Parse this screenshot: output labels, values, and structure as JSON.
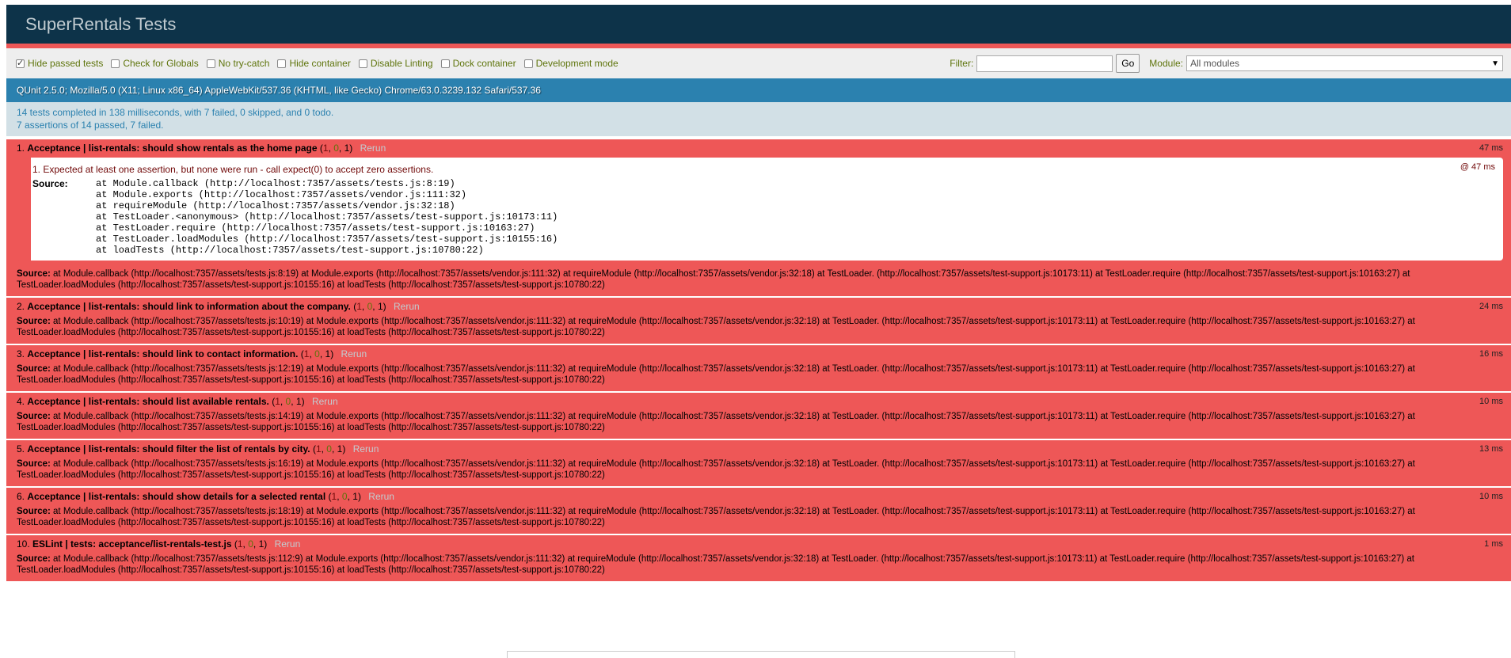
{
  "header": {
    "title": "SuperRentals Tests"
  },
  "toolbar": {
    "checkboxes": [
      {
        "label": "Hide passed tests",
        "checked": true
      },
      {
        "label": "Check for Globals",
        "checked": false
      },
      {
        "label": "No try-catch",
        "checked": false
      },
      {
        "label": "Hide container",
        "checked": false
      },
      {
        "label": "Disable Linting",
        "checked": false
      },
      {
        "label": "Dock container",
        "checked": false
      },
      {
        "label": "Development mode",
        "checked": false
      }
    ],
    "filter_label": "Filter:",
    "filter_value": "",
    "go_label": "Go",
    "module_label": "Module:",
    "module_selected": "All modules"
  },
  "user_agent": "QUnit 2.5.0; Mozilla/5.0 (X11; Linux x86_64) AppleWebKit/537.36 (KHTML, like Gecko) Chrome/63.0.3239.132 Safari/537.36",
  "result": {
    "line1": "14 tests completed in 138 milliseconds, with 7 failed, 0 skipped, and 0 todo.",
    "line2": "7 assertions of 14 passed, 7 failed."
  },
  "colors": {
    "header_bg": "#0d3349",
    "fail_red": "#ee5757",
    "ua_blue": "#2b81af",
    "result_bg": "#d2e0e6"
  },
  "rerun_label": "Rerun",
  "source_label": "Source:",
  "tests": [
    {
      "index": "1.",
      "module": "Acceptance | list-rentals:",
      "name": "should show rentals as the home page",
      "failed": "1",
      "passed": "0",
      "total": "1",
      "runtime": "47 ms",
      "assertion": {
        "message": "1. Expected at least one assertion, but none were run - call expect(0) to accept zero assertions.",
        "runtime": "@ 47 ms",
        "source_label": "Source:",
        "stack": "at Module.callback (http://localhost:7357/assets/tests.js:8:19)\nat Module.exports (http://localhost:7357/assets/vendor.js:111:32)\nat requireModule (http://localhost:7357/assets/vendor.js:32:18)\nat TestLoader.<anonymous> (http://localhost:7357/assets/test-support.js:10173:11)\nat TestLoader.require (http://localhost:7357/assets/test-support.js:10163:27)\nat TestLoader.loadModules (http://localhost:7357/assets/test-support.js:10155:16)\nat loadTests (http://localhost:7357/assets/test-support.js:10780:22)"
      },
      "source": "at Module.callback (http://localhost:7357/assets/tests.js:8:19) at Module.exports (http://localhost:7357/assets/vendor.js:111:32) at requireModule (http://localhost:7357/assets/vendor.js:32:18) at TestLoader. (http://localhost:7357/assets/test-support.js:10173:11) at TestLoader.require (http://localhost:7357/assets/test-support.js:10163:27) at TestLoader.loadModules (http://localhost:7357/assets/test-support.js:10155:16) at loadTests (http://localhost:7357/assets/test-support.js:10780:22)"
    },
    {
      "index": "2.",
      "module": "Acceptance | list-rentals:",
      "name": "should link to information about the company.",
      "failed": "1",
      "passed": "0",
      "total": "1",
      "runtime": "24 ms",
      "source": "at Module.callback (http://localhost:7357/assets/tests.js:10:19) at Module.exports (http://localhost:7357/assets/vendor.js:111:32) at requireModule (http://localhost:7357/assets/vendor.js:32:18) at TestLoader. (http://localhost:7357/assets/test-support.js:10173:11) at TestLoader.require (http://localhost:7357/assets/test-support.js:10163:27) at TestLoader.loadModules (http://localhost:7357/assets/test-support.js:10155:16) at loadTests (http://localhost:7357/assets/test-support.js:10780:22)"
    },
    {
      "index": "3.",
      "module": "Acceptance | list-rentals:",
      "name": "should link to contact information.",
      "failed": "1",
      "passed": "0",
      "total": "1",
      "runtime": "16 ms",
      "source": "at Module.callback (http://localhost:7357/assets/tests.js:12:19) at Module.exports (http://localhost:7357/assets/vendor.js:111:32) at requireModule (http://localhost:7357/assets/vendor.js:32:18) at TestLoader. (http://localhost:7357/assets/test-support.js:10173:11) at TestLoader.require (http://localhost:7357/assets/test-support.js:10163:27) at TestLoader.loadModules (http://localhost:7357/assets/test-support.js:10155:16) at loadTests (http://localhost:7357/assets/test-support.js:10780:22)"
    },
    {
      "index": "4.",
      "module": "Acceptance | list-rentals:",
      "name": "should list available rentals.",
      "failed": "1",
      "passed": "0",
      "total": "1",
      "runtime": "10 ms",
      "source": "at Module.callback (http://localhost:7357/assets/tests.js:14:19) at Module.exports (http://localhost:7357/assets/vendor.js:111:32) at requireModule (http://localhost:7357/assets/vendor.js:32:18) at TestLoader. (http://localhost:7357/assets/test-support.js:10173:11) at TestLoader.require (http://localhost:7357/assets/test-support.js:10163:27) at TestLoader.loadModules (http://localhost:7357/assets/test-support.js:10155:16) at loadTests (http://localhost:7357/assets/test-support.js:10780:22)"
    },
    {
      "index": "5.",
      "module": "Acceptance | list-rentals:",
      "name": "should filter the list of rentals by city.",
      "failed": "1",
      "passed": "0",
      "total": "1",
      "runtime": "13 ms",
      "source": "at Module.callback (http://localhost:7357/assets/tests.js:16:19) at Module.exports (http://localhost:7357/assets/vendor.js:111:32) at requireModule (http://localhost:7357/assets/vendor.js:32:18) at TestLoader. (http://localhost:7357/assets/test-support.js:10173:11) at TestLoader.require (http://localhost:7357/assets/test-support.js:10163:27) at TestLoader.loadModules (http://localhost:7357/assets/test-support.js:10155:16) at loadTests (http://localhost:7357/assets/test-support.js:10780:22)"
    },
    {
      "index": "6.",
      "module": "Acceptance | list-rentals:",
      "name": "should show details for a selected rental",
      "failed": "1",
      "passed": "0",
      "total": "1",
      "runtime": "10 ms",
      "source": "at Module.callback (http://localhost:7357/assets/tests.js:18:19) at Module.exports (http://localhost:7357/assets/vendor.js:111:32) at requireModule (http://localhost:7357/assets/vendor.js:32:18) at TestLoader. (http://localhost:7357/assets/test-support.js:10173:11) at TestLoader.require (http://localhost:7357/assets/test-support.js:10163:27) at TestLoader.loadModules (http://localhost:7357/assets/test-support.js:10155:16) at loadTests (http://localhost:7357/assets/test-support.js:10780:22)"
    },
    {
      "index": "10.",
      "module": "ESLint | tests:",
      "name": "acceptance/list-rentals-test.js",
      "failed": "1",
      "passed": "0",
      "total": "1",
      "runtime": "1 ms",
      "source": "at Module.callback (http://localhost:7357/assets/tests.js:112:9) at Module.exports (http://localhost:7357/assets/vendor.js:111:32) at requireModule (http://localhost:7357/assets/vendor.js:32:18) at TestLoader. (http://localhost:7357/assets/test-support.js:10173:11) at TestLoader.require (http://localhost:7357/assets/test-support.js:10163:27) at TestLoader.loadModules (http://localhost:7357/assets/test-support.js:10155:16) at loadTests (http://localhost:7357/assets/test-support.js:10780:22)"
    }
  ]
}
